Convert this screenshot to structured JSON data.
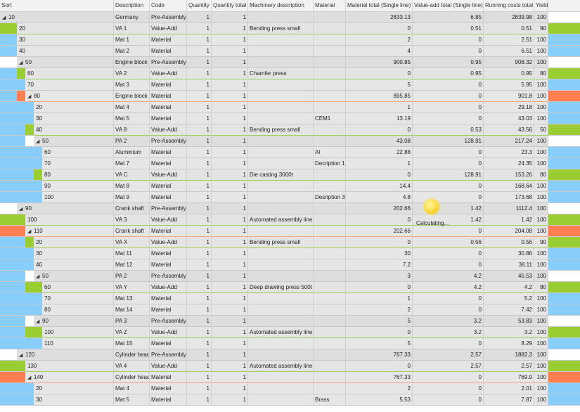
{
  "columns": [
    "Sort",
    "Description",
    "Code",
    "Quantity",
    "Quantity total",
    "Machinery description",
    "Material",
    "Material total (Single line)",
    "Value-add total (Single line)",
    "Running costs total",
    "Yield"
  ],
  "colors": {
    "green": "#9acd32",
    "blue": "#87cefa",
    "orange": "#ff7f50"
  },
  "busy": {
    "text": "Calculating..."
  },
  "rows": [
    {
      "sort": "10",
      "level": 0,
      "tri": true,
      "desc": "Germany",
      "code": "Pre-Assembly",
      "q": "1",
      "qt": "1",
      "mach": "",
      "mat": "",
      "mt": "2833.13",
      "vt": "6.85",
      "rc": "2839.98",
      "y": "100",
      "lead": [],
      "end": ""
    },
    {
      "sort": "20",
      "level": 1,
      "tri": false,
      "desc": "VA 1",
      "code": "Value-Add",
      "q": "1",
      "qt": "1",
      "mach": "Bending press small",
      "mat": "",
      "mt": "0",
      "vt": "0.51",
      "rc": "0.51",
      "y": "90",
      "lead": [
        "green"
      ],
      "end": "green"
    },
    {
      "sort": "30",
      "level": 1,
      "tri": false,
      "desc": "Mat 1",
      "code": "Material",
      "q": "1",
      "qt": "1",
      "mach": "",
      "mat": "",
      "mt": "2",
      "vt": "0",
      "rc": "2.51",
      "y": "100",
      "lead": [
        "blue"
      ],
      "end": "blue"
    },
    {
      "sort": "40",
      "level": 1,
      "tri": false,
      "desc": "Mat 2",
      "code": "Material",
      "q": "1",
      "qt": "1",
      "mach": "",
      "mat": "",
      "mt": "4",
      "vt": "0",
      "rc": "6.51",
      "y": "100",
      "lead": [
        "blue"
      ],
      "end": "blue"
    },
    {
      "sort": "50",
      "level": 1,
      "tri": true,
      "desc": "Engine block",
      "code": "Pre-Assembly",
      "q": "1",
      "qt": "1",
      "mach": "",
      "mat": "",
      "mt": "900.85",
      "vt": "0.95",
      "rc": "908.32",
      "y": "100",
      "lead": [
        ""
      ],
      "end": ""
    },
    {
      "sort": "60",
      "level": 2,
      "tri": false,
      "desc": "VA 2",
      "code": "Value-Add",
      "q": "1",
      "qt": "1",
      "mach": "Chamfer press",
      "mat": "",
      "mt": "0",
      "vt": "0.95",
      "rc": "0.95",
      "y": "80",
      "lead": [
        "blue",
        "green"
      ],
      "end": "green"
    },
    {
      "sort": "70",
      "level": 2,
      "tri": false,
      "desc": "Mat 3",
      "code": "Material",
      "q": "1",
      "qt": "1",
      "mach": "",
      "mat": "",
      "mt": "5",
      "vt": "0",
      "rc": "5.95",
      "y": "100",
      "lead": [
        "blue",
        "blue"
      ],
      "end": "blue"
    },
    {
      "sort": "80",
      "level": 2,
      "tri": true,
      "desc": "Engine block",
      "code": "Material",
      "q": "1",
      "qt": "1",
      "mach": "",
      "mat": "",
      "mt": "895.85",
      "vt": "0",
      "rc": "901.8",
      "y": "100",
      "lead": [
        "blue",
        "orange"
      ],
      "end": "orange",
      "red": true
    },
    {
      "sort": "20",
      "level": 3,
      "tri": false,
      "desc": "Mat 4",
      "code": "Material",
      "q": "1",
      "qt": "1",
      "mach": "",
      "mat": "",
      "mt": "1",
      "vt": "0",
      "rc": "29.18",
      "y": "100",
      "lead": [
        "blue",
        "blue",
        "blue"
      ],
      "end": "blue"
    },
    {
      "sort": "30",
      "level": 3,
      "tri": false,
      "desc": "Mat 5",
      "code": "Material",
      "q": "1",
      "qt": "1",
      "mach": "",
      "mat": "CEM1",
      "mt": "13.19",
      "vt": "0",
      "rc": "43.03",
      "y": "100",
      "lead": [
        "blue",
        "blue",
        "blue"
      ],
      "end": "blue"
    },
    {
      "sort": "40",
      "level": 3,
      "tri": false,
      "desc": "VA 8",
      "code": "Value-Add",
      "q": "1",
      "qt": "1",
      "mach": "Bending press small",
      "mat": "",
      "mt": "0",
      "vt": "0.53",
      "rc": "43.56",
      "y": "50",
      "lead": [
        "blue",
        "blue",
        "green"
      ],
      "end": "green"
    },
    {
      "sort": "50",
      "level": 3,
      "tri": true,
      "desc": "PA 2",
      "code": "Pre-Assembly",
      "q": "1",
      "qt": "1",
      "mach": "",
      "mat": "",
      "mt": "43.08",
      "vt": "128.91",
      "rc": "217.24",
      "y": "100",
      "lead": [
        "blue",
        "blue",
        ""
      ],
      "end": ""
    },
    {
      "sort": "60",
      "level": 4,
      "tri": false,
      "desc": "Aluminium",
      "code": "Material",
      "q": "1",
      "qt": "1",
      "mach": "",
      "mat": "Al",
      "mt": "22.88",
      "vt": "0",
      "rc": "23.3",
      "y": "100",
      "lead": [
        "blue",
        "blue",
        "blue",
        "blue"
      ],
      "end": "blue"
    },
    {
      "sort": "70",
      "level": 4,
      "tri": false,
      "desc": "Mat 7",
      "code": "Material",
      "q": "1",
      "qt": "1",
      "mach": "",
      "mat": "Decription 1",
      "mt": "1",
      "vt": "0",
      "rc": "24.35",
      "y": "100",
      "lead": [
        "blue",
        "blue",
        "blue",
        "blue"
      ],
      "end": "blue"
    },
    {
      "sort": "80",
      "level": 4,
      "tri": false,
      "desc": "VA C",
      "code": "Value-Add",
      "q": "1",
      "qt": "1",
      "mach": "Die casting 3000t",
      "mat": "",
      "mt": "0",
      "vt": "128.91",
      "rc": "153.26",
      "y": "80",
      "lead": [
        "blue",
        "blue",
        "blue",
        "green"
      ],
      "end": "green"
    },
    {
      "sort": "90",
      "level": 4,
      "tri": false,
      "desc": "Mat 8",
      "code": "Material",
      "q": "1",
      "qt": "1",
      "mach": "",
      "mat": "",
      "mt": "14.4",
      "vt": "0",
      "rc": "168.64",
      "y": "100",
      "lead": [
        "blue",
        "blue",
        "blue",
        "blue"
      ],
      "end": "blue"
    },
    {
      "sort": "100",
      "level": 4,
      "tri": false,
      "desc": "Mat 9",
      "code": "Material",
      "q": "1",
      "qt": "1",
      "mach": "",
      "mat": "Desription 3",
      "mt": "4.8",
      "vt": "0",
      "rc": "173.68",
      "y": "100",
      "lead": [
        "blue",
        "blue",
        "blue",
        "blue"
      ],
      "end": "blue"
    },
    {
      "sort": "90",
      "level": 1,
      "tri": true,
      "desc": "Crank shaft",
      "code": "Pre-Assembly",
      "q": "1",
      "qt": "1",
      "mach": "",
      "mat": "",
      "mt": "202.66",
      "vt": "1.42",
      "rc": "1112.4",
      "y": "100",
      "lead": [
        ""
      ],
      "end": ""
    },
    {
      "sort": "100",
      "level": 2,
      "tri": false,
      "desc": "VA 3",
      "code": "Value-Add",
      "q": "1",
      "qt": "1",
      "mach": "Automated assembly line",
      "mat": "",
      "mt": "0",
      "vt": "1.42",
      "rc": "1.42",
      "y": "100",
      "lead": [
        "green",
        "green"
      ],
      "end": "green"
    },
    {
      "sort": "110",
      "level": 2,
      "tri": true,
      "desc": "Crank shaft",
      "code": "Material",
      "q": "1",
      "qt": "1",
      "mach": "",
      "mat": "",
      "mt": "202.66",
      "vt": "0",
      "rc": "204.08",
      "y": "100",
      "lead": [
        "orange",
        "orange"
      ],
      "end": "orange",
      "red": true
    },
    {
      "sort": "20",
      "level": 3,
      "tri": false,
      "desc": "VA X",
      "code": "Value-Add",
      "q": "1",
      "qt": "1",
      "mach": "Bending press small",
      "mat": "",
      "mt": "0",
      "vt": "0.56",
      "rc": "0.56",
      "y": "90",
      "lead": [
        "blue",
        "blue",
        "green"
      ],
      "end": "green"
    },
    {
      "sort": "30",
      "level": 3,
      "tri": false,
      "desc": "Mat 11",
      "code": "Material",
      "q": "1",
      "qt": "1",
      "mach": "",
      "mat": "",
      "mt": "30",
      "vt": "0",
      "rc": "30.86",
      "y": "100",
      "lead": [
        "blue",
        "blue",
        "blue"
      ],
      "end": "blue"
    },
    {
      "sort": "40",
      "level": 3,
      "tri": false,
      "desc": "Mat 12",
      "code": "Material",
      "q": "1",
      "qt": "1",
      "mach": "",
      "mat": "",
      "mt": "7.2",
      "vt": "0",
      "rc": "38.11",
      "y": "100",
      "lead": [
        "blue",
        "blue",
        "blue"
      ],
      "end": "blue"
    },
    {
      "sort": "50",
      "level": 3,
      "tri": true,
      "desc": "PA 2",
      "code": "Pre-Assembly",
      "q": "1",
      "qt": "1",
      "mach": "",
      "mat": "",
      "mt": "3",
      "vt": "4.2",
      "rc": "45.53",
      "y": "100",
      "lead": [
        "blue",
        "blue",
        ""
      ],
      "end": ""
    },
    {
      "sort": "60",
      "level": 4,
      "tri": false,
      "desc": "VA Y",
      "code": "Value-Add",
      "q": "1",
      "qt": "1",
      "mach": "Deep drawing press 500t",
      "mat": "",
      "mt": "0",
      "vt": "4.2",
      "rc": "4.2",
      "y": "80",
      "lead": [
        "blue",
        "blue",
        "green",
        "green"
      ],
      "end": "green"
    },
    {
      "sort": "70",
      "level": 4,
      "tri": false,
      "desc": "Mat 13",
      "code": "Material",
      "q": "1",
      "qt": "1",
      "mach": "",
      "mat": "",
      "mt": "1",
      "vt": "0",
      "rc": "5.2",
      "y": "100",
      "lead": [
        "blue",
        "blue",
        "blue",
        "blue"
      ],
      "end": "blue"
    },
    {
      "sort": "80",
      "level": 4,
      "tri": false,
      "desc": "Mat 14",
      "code": "Material",
      "q": "1",
      "qt": "1",
      "mach": "",
      "mat": "",
      "mt": "2",
      "vt": "0",
      "rc": "7.42",
      "y": "100",
      "lead": [
        "blue",
        "blue",
        "blue",
        "blue"
      ],
      "end": "blue"
    },
    {
      "sort": "90",
      "level": 3,
      "tri": true,
      "desc": "PA 3",
      "code": "Pre-Assembly",
      "q": "1",
      "qt": "1",
      "mach": "",
      "mat": "",
      "mt": "5",
      "vt": "3.2",
      "rc": "53.83",
      "y": "100",
      "lead": [
        "blue",
        "blue",
        ""
      ],
      "end": ""
    },
    {
      "sort": "100",
      "level": 4,
      "tri": false,
      "desc": "VA Z",
      "code": "Value-Add",
      "q": "1",
      "qt": "1",
      "mach": "Automated assembly line",
      "mat": "",
      "mt": "0",
      "vt": "3.2",
      "rc": "3.2",
      "y": "100",
      "lead": [
        "blue",
        "blue",
        "green",
        "green"
      ],
      "end": "green"
    },
    {
      "sort": "110",
      "level": 4,
      "tri": false,
      "desc": "Mat 15",
      "code": "Material",
      "q": "1",
      "qt": "1",
      "mach": "",
      "mat": "",
      "mt": "5",
      "vt": "0",
      "rc": "8.29",
      "y": "100",
      "lead": [
        "blue",
        "blue",
        "blue",
        "blue"
      ],
      "end": "blue"
    },
    {
      "sort": "120",
      "level": 1,
      "tri": true,
      "desc": "Cylinder head",
      "code": "Pre-Assembly",
      "q": "1",
      "qt": "1",
      "mach": "",
      "mat": "",
      "mt": "767.33",
      "vt": "2.57",
      "rc": "1882.3",
      "y": "100",
      "lead": [
        ""
      ],
      "end": ""
    },
    {
      "sort": "130",
      "level": 2,
      "tri": false,
      "desc": "VA 4",
      "code": "Value-Add",
      "q": "1",
      "qt": "1",
      "mach": "Automated assembly line",
      "mat": "",
      "mt": "0",
      "vt": "2.57",
      "rc": "2.57",
      "y": "100",
      "lead": [
        "green",
        "green"
      ],
      "end": "green"
    },
    {
      "sort": "140",
      "level": 2,
      "tri": true,
      "desc": "Cylinder head",
      "code": "Material",
      "q": "1",
      "qt": "1",
      "mach": "",
      "mat": "",
      "mt": "767.33",
      "vt": "0",
      "rc": "769.9",
      "y": "100",
      "lead": [
        "orange",
        "orange"
      ],
      "end": "orange",
      "red": true
    },
    {
      "sort": "20",
      "level": 3,
      "tri": false,
      "desc": "Mat 4",
      "code": "Material",
      "q": "1",
      "qt": "1",
      "mach": "",
      "mat": "",
      "mt": "2",
      "vt": "0",
      "rc": "2.01",
      "y": "100",
      "lead": [
        "blue",
        "blue",
        "blue"
      ],
      "end": "blue"
    },
    {
      "sort": "30",
      "level": 3,
      "tri": false,
      "desc": "Mat 5",
      "code": "Material",
      "q": "1",
      "qt": "1",
      "mach": "",
      "mat": "Brass",
      "mt": "5.53",
      "vt": "0",
      "rc": "7.87",
      "y": "100",
      "lead": [
        "blue",
        "blue",
        "blue"
      ],
      "end": "blue"
    }
  ]
}
